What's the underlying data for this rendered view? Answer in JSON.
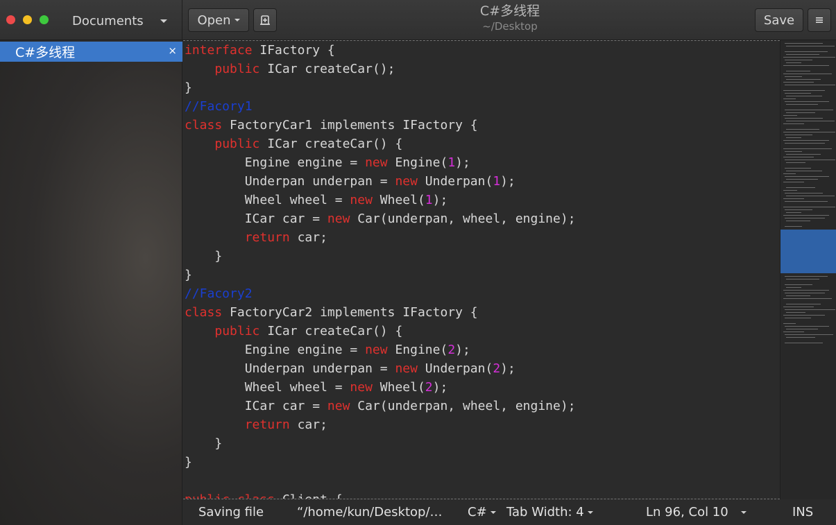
{
  "sidebar_header": {
    "label": "Documents"
  },
  "toolbar": {
    "open_label": "Open",
    "save_label": "Save"
  },
  "title": {
    "name": "C#多线程",
    "path": "~/Desktop"
  },
  "documents": [
    {
      "name": "C#多线程",
      "close": "×"
    }
  ],
  "editor": {
    "lines": [
      [
        [
          "kw",
          "interface"
        ],
        [
          "t",
          " IFactory {"
        ]
      ],
      [
        [
          "t",
          "    "
        ],
        [
          "kw",
          "public"
        ],
        [
          "t",
          " ICar createCar();"
        ]
      ],
      [
        [
          "t",
          "}"
        ]
      ],
      [
        [
          "cm",
          "//Facory1"
        ]
      ],
      [
        [
          "kw",
          "class"
        ],
        [
          "t",
          " FactoryCar1 implements IFactory {"
        ]
      ],
      [
        [
          "t",
          "    "
        ],
        [
          "kw",
          "public"
        ],
        [
          "t",
          " ICar createCar() {"
        ]
      ],
      [
        [
          "t",
          "        Engine engine = "
        ],
        [
          "kw",
          "new"
        ],
        [
          "t",
          " Engine("
        ],
        [
          "nm",
          "1"
        ],
        [
          "t",
          ");"
        ]
      ],
      [
        [
          "t",
          "        Underpan underpan = "
        ],
        [
          "kw",
          "new"
        ],
        [
          "t",
          " Underpan("
        ],
        [
          "nm",
          "1"
        ],
        [
          "t",
          ");"
        ]
      ],
      [
        [
          "t",
          "        Wheel wheel = "
        ],
        [
          "kw",
          "new"
        ],
        [
          "t",
          " Wheel("
        ],
        [
          "nm",
          "1"
        ],
        [
          "t",
          ");"
        ]
      ],
      [
        [
          "t",
          "        ICar car = "
        ],
        [
          "kw",
          "new"
        ],
        [
          "t",
          " Car(underpan, wheel, engine);"
        ]
      ],
      [
        [
          "t",
          "        "
        ],
        [
          "kw",
          "return"
        ],
        [
          "t",
          " car;"
        ]
      ],
      [
        [
          "t",
          "    }"
        ]
      ],
      [
        [
          "t",
          "}"
        ]
      ],
      [
        [
          "cm",
          "//Facory2"
        ]
      ],
      [
        [
          "kw",
          "class"
        ],
        [
          "t",
          " FactoryCar2 implements IFactory {"
        ]
      ],
      [
        [
          "t",
          "    "
        ],
        [
          "kw",
          "public"
        ],
        [
          "t",
          " ICar createCar() {"
        ]
      ],
      [
        [
          "t",
          "        Engine engine = "
        ],
        [
          "kw",
          "new"
        ],
        [
          "t",
          " Engine("
        ],
        [
          "nm",
          "2"
        ],
        [
          "t",
          ");"
        ]
      ],
      [
        [
          "t",
          "        Underpan underpan = "
        ],
        [
          "kw",
          "new"
        ],
        [
          "t",
          " Underpan("
        ],
        [
          "nm",
          "2"
        ],
        [
          "t",
          ");"
        ]
      ],
      [
        [
          "t",
          "        Wheel wheel = "
        ],
        [
          "kw",
          "new"
        ],
        [
          "t",
          " Wheel("
        ],
        [
          "nm",
          "2"
        ],
        [
          "t",
          ");"
        ]
      ],
      [
        [
          "t",
          "        ICar car = "
        ],
        [
          "kw",
          "new"
        ],
        [
          "t",
          " Car(underpan, wheel, engine);"
        ]
      ],
      [
        [
          "t",
          "        "
        ],
        [
          "kw",
          "return"
        ],
        [
          "t",
          " car;"
        ]
      ],
      [
        [
          "t",
          "    }"
        ]
      ],
      [
        [
          "t",
          "}"
        ]
      ],
      [
        [
          "t",
          ""
        ]
      ],
      [
        [
          "kw",
          "public"
        ],
        [
          "t",
          " "
        ],
        [
          "kw",
          "class"
        ],
        [
          "t",
          " Client {"
        ]
      ]
    ]
  },
  "statusbar": {
    "message": "Saving file",
    "filepath": "“/home/kun/Desktop/…",
    "language": "C#",
    "tab_width": "Tab Width: 4",
    "position": "Ln 96, Col 10",
    "mode": "INS"
  },
  "colors": {
    "keyword": "#e0312e",
    "comment": "#1a3fd1",
    "number": "#d52fd8",
    "selection": "#3b78c9"
  },
  "icons": {
    "new_tab": "new-tab-icon",
    "menu": "hamburger-menu-icon"
  }
}
